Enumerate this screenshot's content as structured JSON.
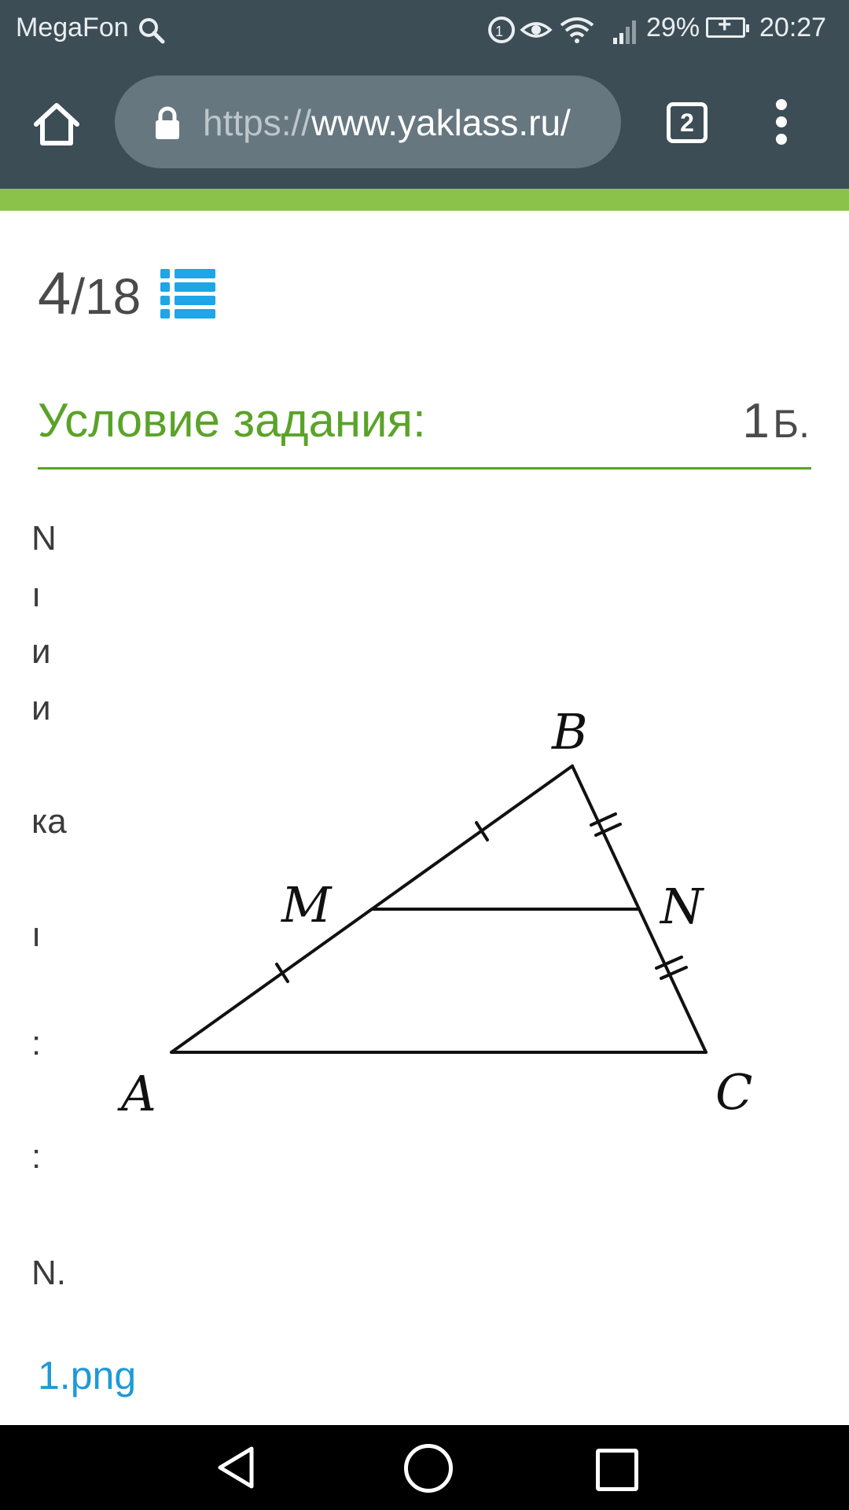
{
  "status_bar": {
    "carrier": "MegaFon",
    "battery": "29%",
    "time": "20:27",
    "icons": [
      "search-icon",
      "data-saver-icon",
      "eye-icon",
      "wifi-icon",
      "signal-icon",
      "battery-charging-icon"
    ]
  },
  "browser": {
    "url_scheme": "https://",
    "url_host": "www.yaklass.ru/",
    "tab_count": "2",
    "icons": [
      "home-icon",
      "lock-icon",
      "tabs-icon",
      "overflow-menu-icon"
    ]
  },
  "colors": {
    "toolbar": "#3d4d56",
    "accent_green": "#5aa328",
    "progress_green": "#8bc34a",
    "link_blue": "#1e9ad6",
    "list_icon_blue": "#1ea6e6"
  },
  "task": {
    "counter_current": "4",
    "counter_separator": "/",
    "counter_total": "18",
    "heading": "Условие задания:",
    "points_value": "1",
    "points_unit": "Б.",
    "text_fragments": [
      "N",
      "ı",
      "и",
      "и",
      "ка",
      "ı",
      ":",
      ":",
      "N."
    ],
    "attachment": "1.png"
  },
  "figure": {
    "labels": {
      "a": "A",
      "b": "B",
      "c": "C",
      "m": "M",
      "n": "N"
    }
  },
  "nav_bar": {
    "icons": [
      "back-icon",
      "home-circle-icon",
      "recents-icon"
    ]
  }
}
